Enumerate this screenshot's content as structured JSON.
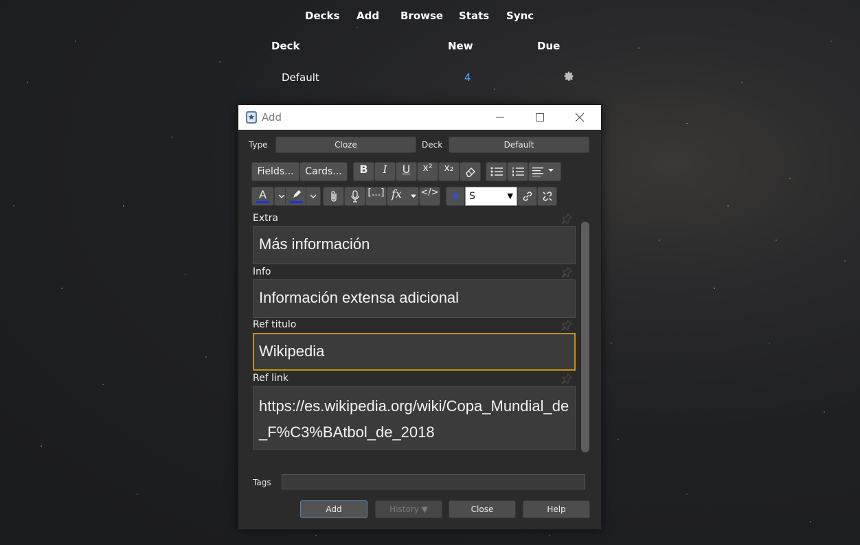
{
  "nav": {
    "decks": "Decks",
    "add": "Add",
    "browse": "Browse",
    "stats": "Stats",
    "sync": "Sync"
  },
  "deck_table": {
    "headers": {
      "deck": "Deck",
      "new": "New",
      "due": "Due"
    },
    "rows": [
      {
        "name": "Default",
        "new": "4",
        "due": ""
      }
    ]
  },
  "dialog": {
    "title": "Add",
    "type_label": "Type",
    "type_value": "Cloze",
    "deck_label": "Deck",
    "deck_value": "Default",
    "toolbar": {
      "fields_label": "Fields...",
      "cards_label": "Cards...",
      "font_size_value": "S"
    },
    "fields": [
      {
        "name": "Extra",
        "value": "Más información"
      },
      {
        "name": "Info",
        "value": "Información extensa adicional"
      },
      {
        "name": "Ref titulo",
        "value": "Wikipedia"
      },
      {
        "name": "Ref link",
        "value": "https://es.wikipedia.org/wiki/Copa_Mundial_de_F%C3%BAtbol_de_2018"
      }
    ],
    "tags_label": "Tags",
    "tags_value": "",
    "buttons": {
      "add": "Add",
      "history": "History ▼",
      "close": "Close",
      "help": "Help"
    }
  },
  "colors": {
    "accent_focus": "#c4901b",
    "link_blue": "#4da3ff",
    "text_color_swatch": "#1d33e0",
    "highlight_swatch": "#1d33e0",
    "primary_button_border": "#5b86b8"
  }
}
